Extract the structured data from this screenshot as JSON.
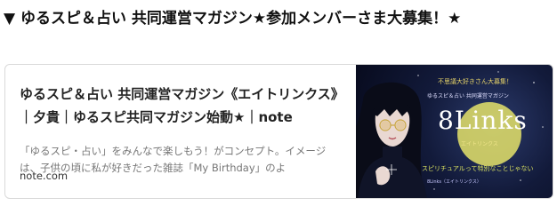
{
  "heading": "▼ ゆるスピ＆占い 共同運営マガジン★参加メンバーさま大募集！★",
  "card": {
    "title": "ゆるスピ＆占い 共同運営マガジン《エイトリンクス》｜夕貴｜ゆるスピ共同マガジン始動★｜note",
    "description": "「ゆるスピ・占い」をみんなで楽しもう！がコンセプト。イメージは、子供の頃に私が好きだった雑誌「My Birthday」のよ",
    "domain": "note.com",
    "thumbnail": {
      "tagline": "不思議大好きさん大募集！",
      "subtitle": "ゆるスピ＆占い 共同運営マガジン",
      "logo": "8Links",
      "logo_sub": "エイトリンクス",
      "slogan": "スピリチュアルって特別なことじゃない",
      "small_text": "8Links（エイトリンクス）",
      "colors": {
        "background": "#0b1030",
        "accent": "#e8e06a",
        "moon": "#e5e36a"
      }
    }
  }
}
